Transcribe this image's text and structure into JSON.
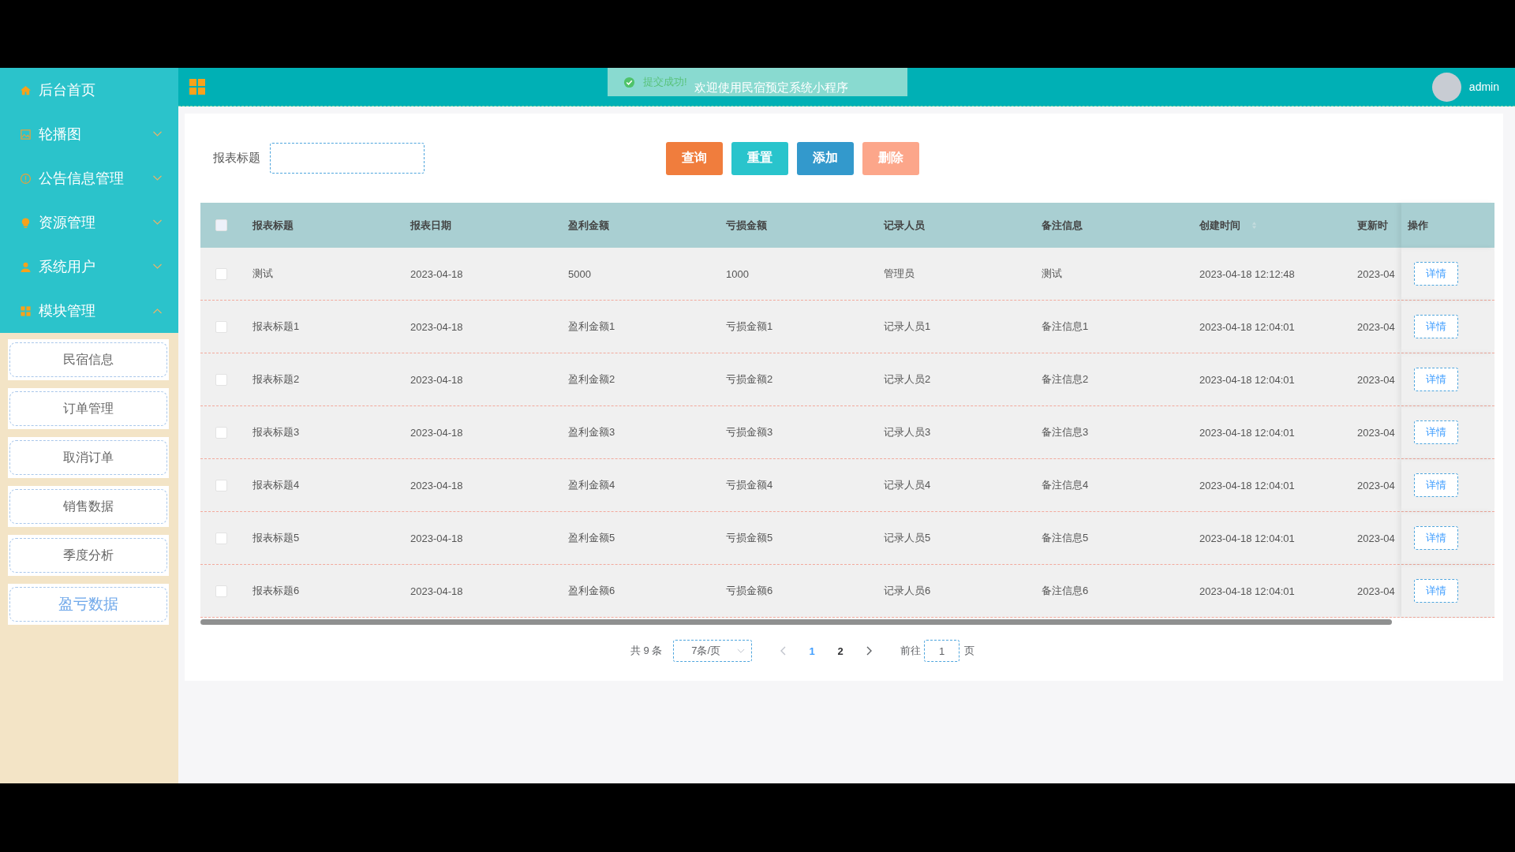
{
  "sidebar": {
    "items": [
      {
        "label": "后台首页",
        "kind": "link"
      },
      {
        "label": "轮播图",
        "kind": "menu",
        "expanded": false
      },
      {
        "label": "公告信息管理",
        "kind": "menu",
        "expanded": false
      },
      {
        "label": "资源管理",
        "kind": "menu",
        "expanded": false
      },
      {
        "label": "系统用户",
        "kind": "menu",
        "expanded": false
      },
      {
        "label": "模块管理",
        "kind": "menu",
        "expanded": true,
        "children": [
          {
            "label": "民宿信息",
            "selected": false
          },
          {
            "label": "订单管理",
            "selected": false
          },
          {
            "label": "取消订单",
            "selected": false
          },
          {
            "label": "销售数据",
            "selected": false
          },
          {
            "label": "季度分析",
            "selected": false
          },
          {
            "label": "盈亏数据",
            "selected": true
          }
        ]
      }
    ]
  },
  "topbar": {
    "toast": "提交成功!",
    "welcome": "欢迎使用民宿预定系统小程序",
    "user": "admin"
  },
  "search": {
    "label": "报表标题"
  },
  "buttons": [
    {
      "label": "查询",
      "kind": "query"
    },
    {
      "label": "重置",
      "kind": "reset"
    },
    {
      "label": "添加",
      "kind": "add"
    },
    {
      "label": "删除",
      "kind": "delete"
    }
  ],
  "table": {
    "select_all_checked": false,
    "columns": [
      "报表标题",
      "报表日期",
      "盈利金额",
      "亏损金额",
      "记录人员",
      "备注信息",
      "创建时间",
      "更新时",
      "操作"
    ],
    "rows": [
      {
        "checked": false,
        "cells": [
          "测试",
          "2023-04-18",
          "5000",
          "1000",
          "管理员",
          "测试",
          "2023-04-18 12:12:48",
          "2023-04"
        ],
        "action": "详情"
      },
      {
        "checked": false,
        "cells": [
          "报表标题1",
          "2023-04-18",
          "盈利金额1",
          "亏损金额1",
          "记录人员1",
          "备注信息1",
          "2023-04-18 12:04:01",
          "2023-04"
        ],
        "action": "详情"
      },
      {
        "checked": false,
        "cells": [
          "报表标题2",
          "2023-04-18",
          "盈利金额2",
          "亏损金额2",
          "记录人员2",
          "备注信息2",
          "2023-04-18 12:04:01",
          "2023-04"
        ],
        "action": "详情"
      },
      {
        "checked": false,
        "cells": [
          "报表标题3",
          "2023-04-18",
          "盈利金额3",
          "亏损金额3",
          "记录人员3",
          "备注信息3",
          "2023-04-18 12:04:01",
          "2023-04"
        ],
        "action": "详情"
      },
      {
        "checked": false,
        "cells": [
          "报表标题4",
          "2023-04-18",
          "盈利金额4",
          "亏损金额4",
          "记录人员4",
          "备注信息4",
          "2023-04-18 12:04:01",
          "2023-04"
        ],
        "action": "详情"
      },
      {
        "checked": false,
        "cells": [
          "报表标题5",
          "2023-04-18",
          "盈利金额5",
          "亏损金额5",
          "记录人员5",
          "备注信息5",
          "2023-04-18 12:04:01",
          "2023-04"
        ],
        "action": "详情"
      },
      {
        "checked": false,
        "cells": [
          "报表标题6",
          "2023-04-18",
          "盈利金额6",
          "亏损金额6",
          "记录人员6",
          "备注信息6",
          "2023-04-18 12:04:01",
          "2023-04"
        ],
        "action": "详情"
      }
    ]
  },
  "pagination": {
    "total": "共 9 条",
    "page_size": "7条/页",
    "pages": [
      {
        "label": "1",
        "selected": true
      },
      {
        "label": "2",
        "selected": false
      }
    ],
    "goto_label": "前往",
    "goto_value": "1",
    "goto_suffix": "页"
  }
}
